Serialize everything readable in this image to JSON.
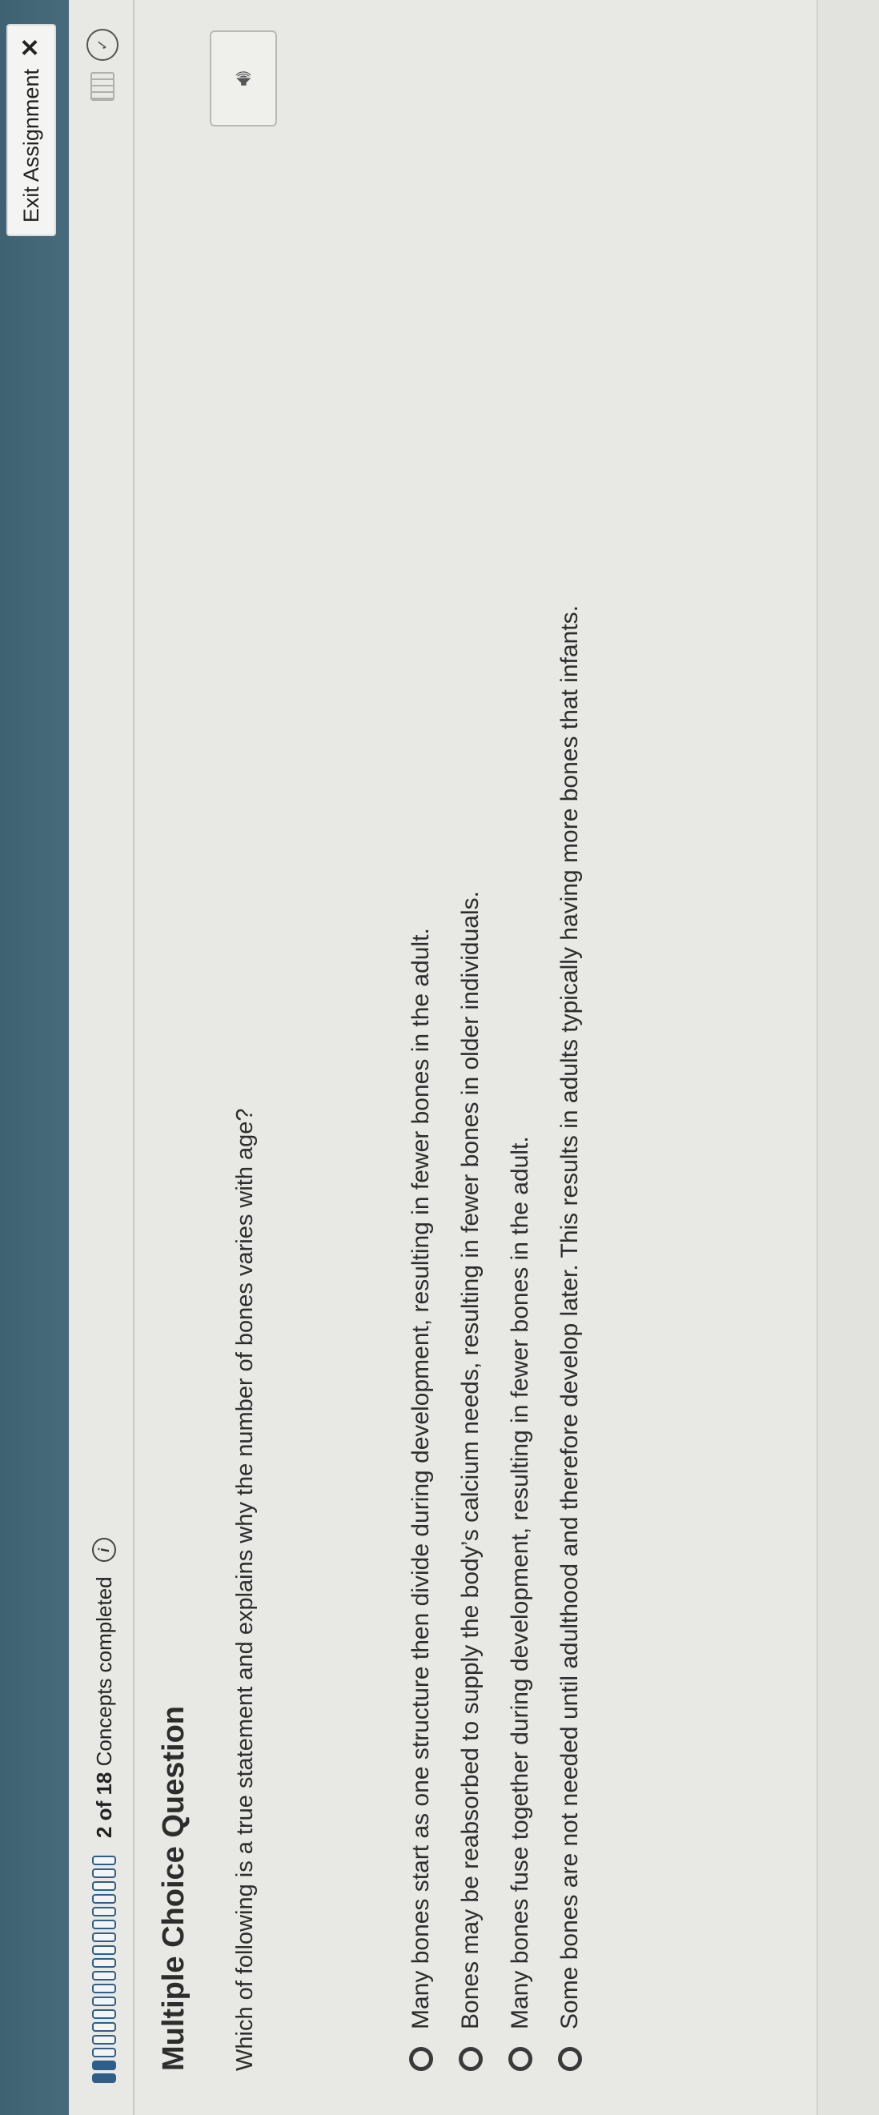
{
  "header": {
    "exit_label": "Exit Assignment",
    "exit_icon": "close-icon"
  },
  "progress": {
    "completed": "2 of 18",
    "suffix": "Concepts completed",
    "total_segments": 18,
    "done_segments": 2,
    "info_icon": "info-icon"
  },
  "question": {
    "title": "Multiple Choice Question",
    "prompt": "Which of following is a true statement and explains why the number of bones varies with age?",
    "options": [
      "Many bones start as one structure then divide during development, resulting in fewer bones in the adult.",
      "Bones may be reabsorbed to supply the body’s calcium needs, resulting in fewer bones in older individuals.",
      "Many bones fuse together during development, resulting in fewer bones in the adult.",
      "Some bones are not needed until adulthood and therefore develop later. This results in adults typically having more bones that infants."
    ]
  },
  "icons": {
    "audio": "speaker-icon",
    "calendar": "calendar-icon",
    "check": "check-circle-icon"
  }
}
